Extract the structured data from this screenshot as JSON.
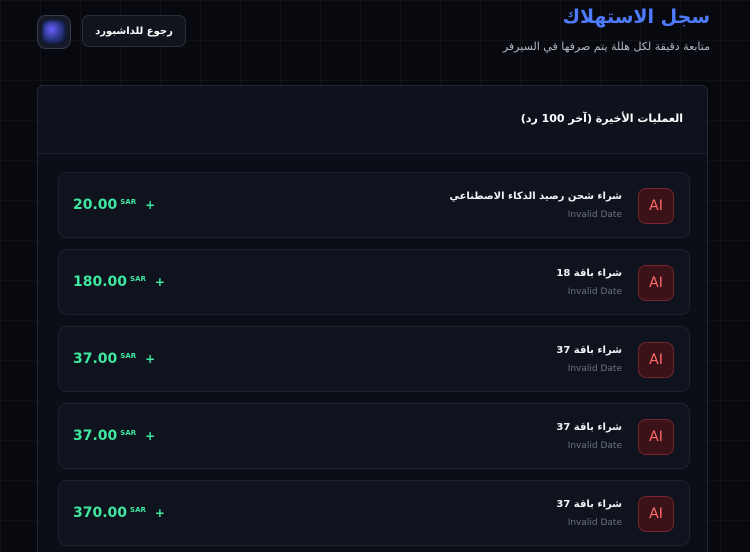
{
  "header": {
    "title": "سجل الاستهلاك",
    "subtitle": "متابعة دقيقة لكل هللة يتم صرفها في السيرفر",
    "back_label": "رجوع للداشبورد"
  },
  "panel": {
    "title": "العمليات الأخيرة (آخر 100 رد)"
  },
  "transactions": [
    {
      "badge": "AI",
      "title": "شراء شحن رصيد الذكاء الاصطناعي",
      "date": "Invalid Date",
      "amount": "20.00",
      "currency": "SAR",
      "sign": "+"
    },
    {
      "badge": "AI",
      "title": "شراء باقة 18",
      "date": "Invalid Date",
      "amount": "180.00",
      "currency": "SAR",
      "sign": "+"
    },
    {
      "badge": "AI",
      "title": "شراء باقة 37",
      "date": "Invalid Date",
      "amount": "37.00",
      "currency": "SAR",
      "sign": "+"
    },
    {
      "badge": "AI",
      "title": "شراء باقة 37",
      "date": "Invalid Date",
      "amount": "37.00",
      "currency": "SAR",
      "sign": "+"
    },
    {
      "badge": "AI",
      "title": "شراء باقة 37",
      "date": "Invalid Date",
      "amount": "370.00",
      "currency": "SAR",
      "sign": "+"
    }
  ],
  "colors": {
    "accent": "#4f7cff",
    "amount": "#3ee8a0",
    "badge": "#ff6b6b"
  }
}
